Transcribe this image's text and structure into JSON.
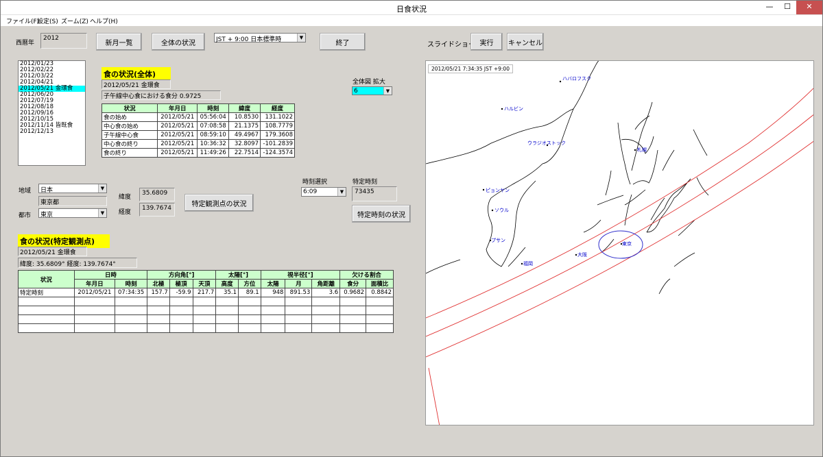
{
  "window": {
    "title": "日食状況",
    "minimize_glyph": "—",
    "maximize_glyph": "☐",
    "close_glyph": "✕"
  },
  "menu": [
    "ファイル(F)",
    "設定(S)",
    "ズーム(Z)",
    "ヘルプ(H)"
  ],
  "toolbar": {
    "year_label": "西暦年",
    "year_value": "2012",
    "new_moon_button": "新月一覧",
    "overall_button": "全体の状況",
    "timezone_value": "JST  + 9:00 日本標準時",
    "exit_button": "終了",
    "slideshow_label": "スライドショー",
    "run_button": "実行",
    "cancel_button": "キャンセル"
  },
  "dates": [
    "2012/01/23",
    "2012/02/22",
    "2012/03/22",
    "2012/04/21",
    "2012/05/21 金環食",
    "2012/06/20",
    "2012/07/19",
    "2012/08/18",
    "2012/09/16",
    "2012/10/15",
    "2012/11/14 皆既食",
    "2012/12/13"
  ],
  "selected_date_index": 4,
  "overall": {
    "heading": "食の状況(全体)",
    "eclipse_name": "2012/05/21 金環食",
    "meridian_mag_label": "子午線中心食における食分",
    "meridian_mag_value": "0.9725",
    "headers": [
      "状況",
      "年月日",
      "時刻",
      "緯度",
      "経度"
    ],
    "rows": [
      [
        "食の始め",
        "2012/05/21",
        "05:56:04",
        "10.8530",
        "131.1022"
      ],
      [
        "中心食の始め",
        "2012/05/21",
        "07:08:58",
        "21.1375",
        "108.7779"
      ],
      [
        "子午線中心食",
        "2012/05/21",
        "08:59:10",
        "49.4967",
        "179.3608"
      ],
      [
        "中心食の終り",
        "2012/05/21",
        "10:36:32",
        "32.8097",
        "-101.2839"
      ],
      [
        "食の終り",
        "2012/05/21",
        "11:49:26",
        "22.7514",
        "-124.3574"
      ]
    ]
  },
  "zoom": {
    "label": "全体図 拡大",
    "value": "6",
    "highlight_color": "#00ffff"
  },
  "location": {
    "region_label": "地域",
    "region_value": "日本",
    "prefecture_value": "東京都",
    "city_label": "都市",
    "city_value": "東京",
    "lat_label": "緯度",
    "lat_value": "35.6809",
    "lon_label": "経度",
    "lon_value": "139.7674",
    "observe_button": "特定観測点の状況"
  },
  "time_select": {
    "label": "時刻選択",
    "value": "6:09",
    "specific_label": "特定時刻",
    "specific_value": "73435",
    "specific_button": "特定時刻の状況"
  },
  "observer": {
    "heading": "食の状況(特定観測点)",
    "eclipse_name": "2012/05/21 金環食",
    "coord_text": "緯度: 35.6809°  経度: 139.7674°",
    "group_headers": [
      "状況",
      "日時",
      "方向角[°]",
      "太陽[°]",
      "視半径[°]",
      "欠ける割合"
    ],
    "sub_headers": [
      "年月日",
      "時刻",
      "北極",
      "極頂",
      "天頂",
      "高度",
      "方位",
      "太陽",
      "月",
      "角距離",
      "食分",
      "面積比"
    ],
    "row": [
      "特定時刻",
      "2012/05/21",
      "07:34:35",
      "157.7",
      "-59.9",
      "217.7",
      "35.1",
      "89.1",
      "948",
      "891.53",
      "3.6",
      "0.9682",
      "0.8842"
    ]
  },
  "map": {
    "timestamp": "2012/05/21  7:34:35  JST +9:00",
    "cities": [
      "ハバロフスク",
      "ハルビン",
      "ウラジオストック",
      "札幌",
      "ピョンヤン",
      "ソウル",
      "プサン",
      "福岡",
      "大阪",
      "東京"
    ],
    "path_color": "#e03030",
    "city_color": "#0000cc"
  }
}
